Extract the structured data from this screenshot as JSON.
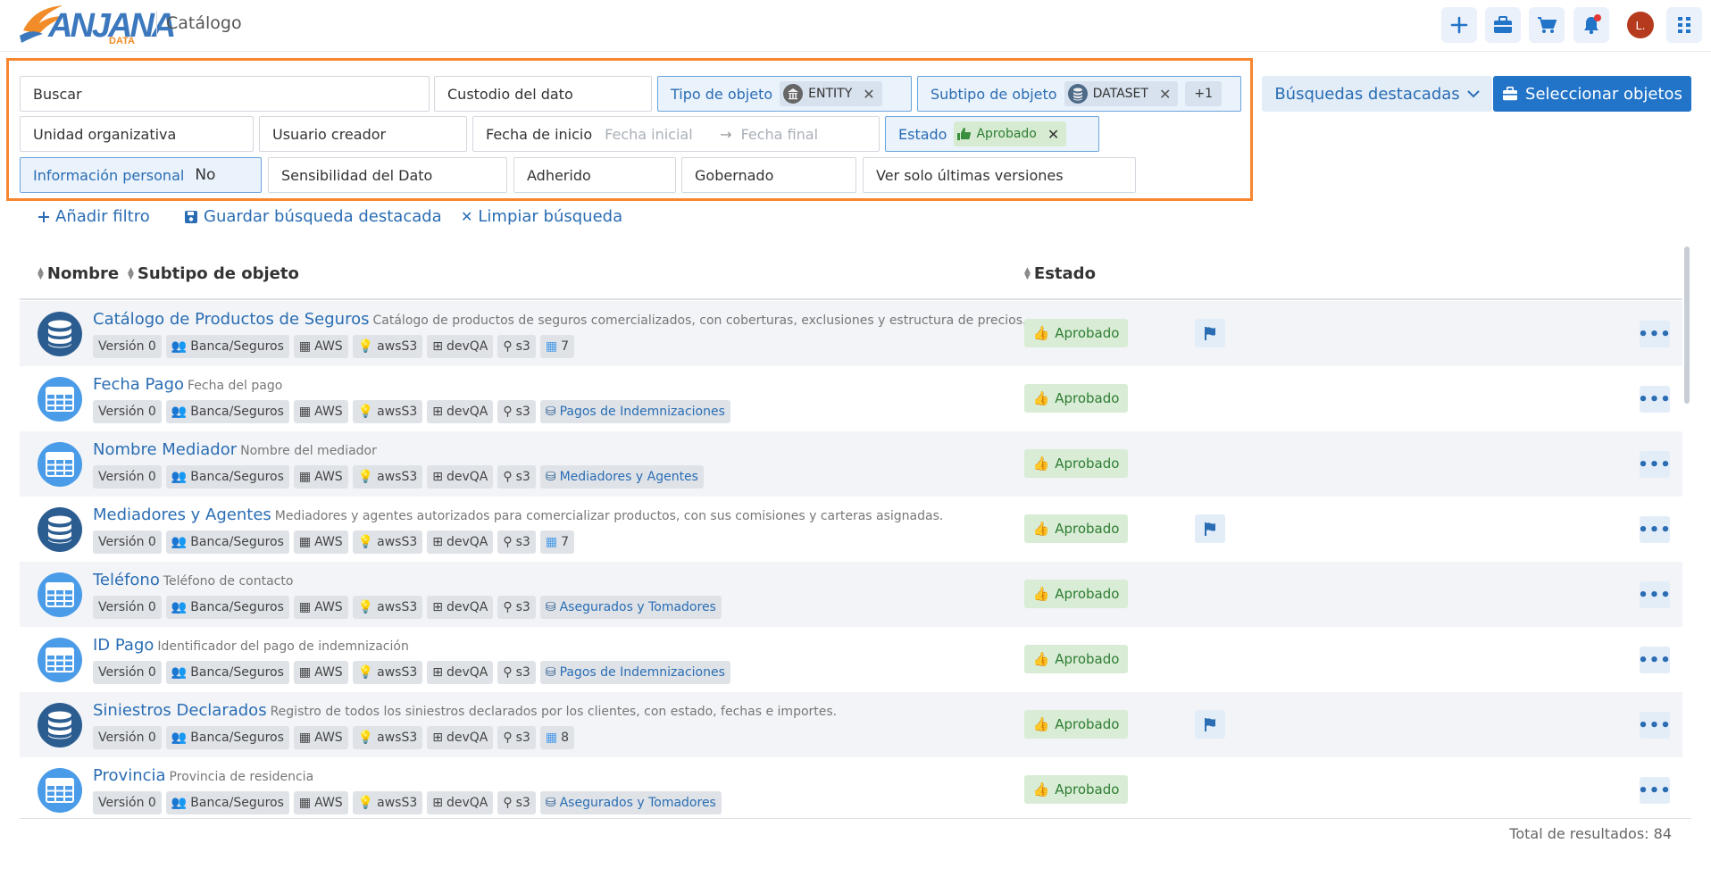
{
  "header": {
    "logo_text": "ANJANA",
    "logo_sub": "DATA",
    "title": "Catálogo",
    "avatar_initial": "L."
  },
  "filters": {
    "search": "Buscar",
    "custodian": "Custodio del dato",
    "object_type_label": "Tipo de objeto",
    "object_type_value": "ENTITY",
    "object_subtype_label": "Subtipo de objeto",
    "object_subtype_value": "DATASET",
    "object_subtype_more": "+1",
    "org_unit": "Unidad organizativa",
    "creator_user": "Usuario creador",
    "start_date_label": "Fecha de inicio",
    "start_date_placeholder": "Fecha inicial",
    "end_date_placeholder": "Fecha final",
    "status_label": "Estado",
    "status_value": "Aprobado",
    "personal_info_label": "Información personal",
    "personal_info_value": "No",
    "sensitivity": "Sensibilidad del Dato",
    "adhered": "Adherido",
    "governed": "Gobernado",
    "latest_versions": "Ver solo últimas versiones"
  },
  "buttons": {
    "featured_searches": "Búsquedas destacadas",
    "select_objects": "Seleccionar objetos",
    "add_filter": "Añadir filtro",
    "save_search": "Guardar búsqueda destacada",
    "clear_search": "Limpiar búsqueda"
  },
  "table": {
    "col_name": "Nombre",
    "col_subtype": "Subtipo de objeto",
    "col_status": "Estado",
    "rows": [
      {
        "icon": "database-icon",
        "name": "Catálogo de Productos de Seguros",
        "desc": "Catálogo de productos de seguros comercializados, con coberturas, exclusiones y estructura de precios.",
        "version": "Versión 0",
        "org": "Banca/Seguros",
        "provider": "AWS",
        "tech": "awsS3",
        "env": "devQA",
        "loc": "s3",
        "extra": "7",
        "extra_type": "count",
        "status": "Aprobado",
        "flag": true
      },
      {
        "icon": "table-icon",
        "name": "Fecha Pago",
        "desc": "Fecha del pago",
        "version": "Versión 0",
        "org": "Banca/Seguros",
        "provider": "AWS",
        "tech": "awsS3",
        "env": "devQA",
        "loc": "s3",
        "extra": "Pagos de Indemnizaciones",
        "extra_type": "link",
        "status": "Aprobado",
        "flag": false
      },
      {
        "icon": "table-icon",
        "name": "Nombre Mediador",
        "desc": "Nombre del mediador",
        "version": "Versión 0",
        "org": "Banca/Seguros",
        "provider": "AWS",
        "tech": "awsS3",
        "env": "devQA",
        "loc": "s3",
        "extra": "Mediadores y Agentes",
        "extra_type": "link",
        "status": "Aprobado",
        "flag": false
      },
      {
        "icon": "database-icon",
        "name": "Mediadores y Agentes",
        "desc": "Mediadores y agentes autorizados para comercializar productos, con sus comisiones y carteras asignadas.",
        "version": "Versión 0",
        "org": "Banca/Seguros",
        "provider": "AWS",
        "tech": "awsS3",
        "env": "devQA",
        "loc": "s3",
        "extra": "7",
        "extra_type": "count",
        "status": "Aprobado",
        "flag": true
      },
      {
        "icon": "table-icon",
        "name": "Teléfono",
        "desc": "Teléfono de contacto",
        "version": "Versión 0",
        "org": "Banca/Seguros",
        "provider": "AWS",
        "tech": "awsS3",
        "env": "devQA",
        "loc": "s3",
        "extra": "Asegurados y Tomadores",
        "extra_type": "link",
        "status": "Aprobado",
        "flag": false
      },
      {
        "icon": "table-icon",
        "name": "ID Pago",
        "desc": "Identificador del pago de indemnización",
        "version": "Versión 0",
        "org": "Banca/Seguros",
        "provider": "AWS",
        "tech": "awsS3",
        "env": "devQA",
        "loc": "s3",
        "extra": "Pagos de Indemnizaciones",
        "extra_type": "link",
        "status": "Aprobado",
        "flag": false
      },
      {
        "icon": "database-icon",
        "name": "Siniestros Declarados",
        "desc": "Registro de todos los siniestros declarados por los clientes, con estado, fechas e importes.",
        "version": "Versión 0",
        "org": "Banca/Seguros",
        "provider": "AWS",
        "tech": "awsS3",
        "env": "devQA",
        "loc": "s3",
        "extra": "8",
        "extra_type": "count",
        "status": "Aprobado",
        "flag": true
      },
      {
        "icon": "table-icon",
        "name": "Provincia",
        "desc": "Provincia de residencia",
        "version": "Versión 0",
        "org": "Banca/Seguros",
        "provider": "AWS",
        "tech": "awsS3",
        "env": "devQA",
        "loc": "s3",
        "extra": "Asegurados y Tomadores",
        "extra_type": "link",
        "status": "Aprobado",
        "flag": false
      }
    ]
  },
  "footer": {
    "total": "Total de resultados: 84"
  },
  "colors": {
    "primary": "#2174c8",
    "highlight_frame": "#f7862f",
    "status_green": "#2e7d32",
    "db_icon": "#2c5d91",
    "table_icon": "#4a9be8"
  }
}
